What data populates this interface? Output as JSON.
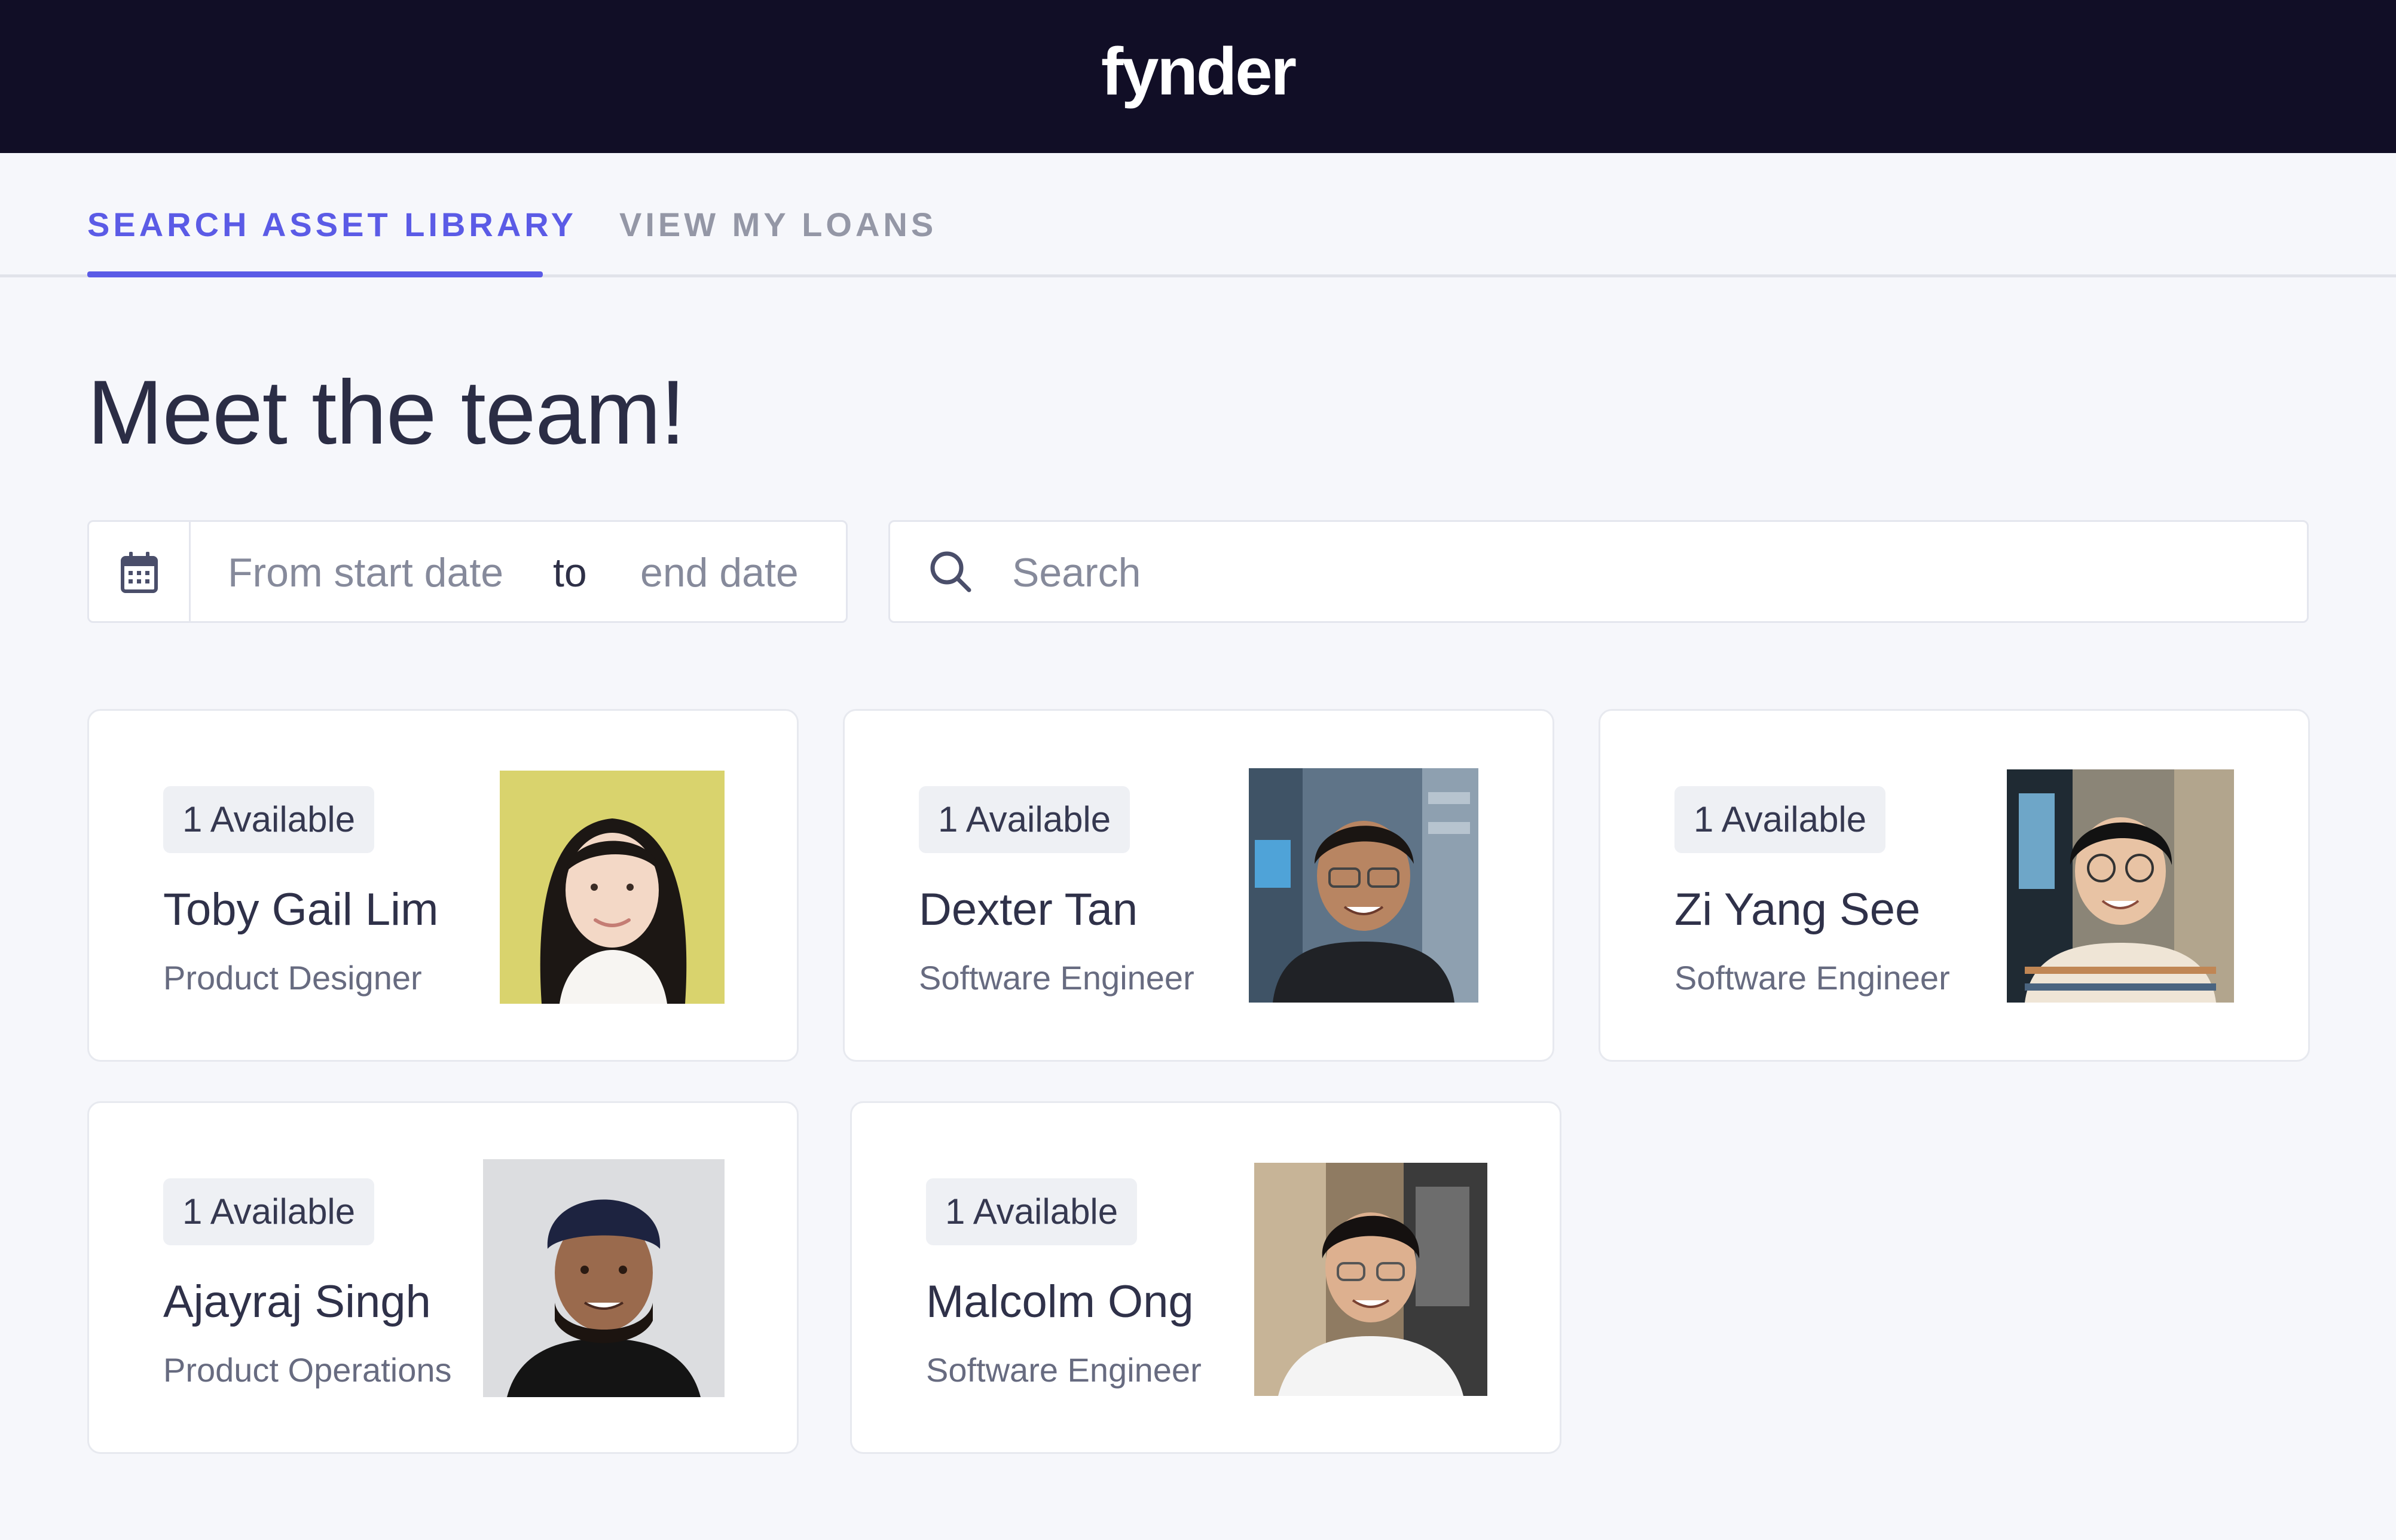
{
  "header": {
    "logo": "fynder"
  },
  "tabs": [
    {
      "label": "SEARCH ASSET LIBRARY",
      "active": true
    },
    {
      "label": "VIEW MY LOANS",
      "active": false
    }
  ],
  "page": {
    "title": "Meet the team!"
  },
  "date_filter": {
    "icon": "calendar-icon",
    "start_placeholder": "From start date",
    "separator": "to",
    "end_placeholder": "end date"
  },
  "search": {
    "icon": "search-icon",
    "placeholder": "Search",
    "value": ""
  },
  "team": [
    {
      "availability": "1 Available",
      "name": "Toby Gail Lim",
      "role": "Product Designer"
    },
    {
      "availability": "1 Available",
      "name": "Dexter Tan",
      "role": "Software Engineer"
    },
    {
      "availability": "1 Available",
      "name": "Zi Yang See",
      "role": "Software Engineer"
    },
    {
      "availability": "1 Available",
      "name": "Ajayraj Singh",
      "role": "Product Operations"
    },
    {
      "availability": "1 Available",
      "name": "Malcolm Ong",
      "role": "Software Engineer"
    }
  ],
  "colors": {
    "header_bg": "#110e26",
    "accent": "#5b5be6",
    "page_bg": "#f6f7fb",
    "inactive_tab": "#9497a6"
  }
}
